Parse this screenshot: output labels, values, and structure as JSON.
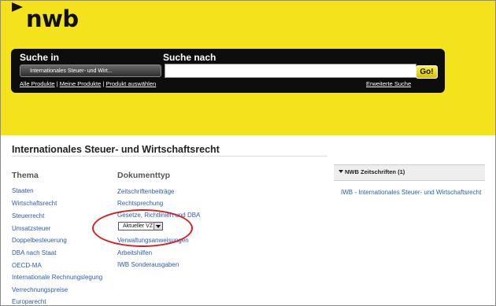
{
  "header": {
    "logo": "nwb",
    "search_in_label": "Suche in",
    "search_for_label": "Suche nach",
    "scope_value": "Internationales Steuer- und Wirt...",
    "query_value": "",
    "go_label": "Go!",
    "links": [
      "Alle Produkte",
      "Meine Produkte",
      "Produkt auswählen"
    ],
    "advanced_search": "Erweiterte Suche"
  },
  "page": {
    "title": "Internationales Steuer- und Wirtschaftsrecht"
  },
  "thema": {
    "heading": "Thema",
    "items": [
      "Staaten",
      "Wirtschaftsrecht",
      "Steuerrecht",
      "Umsatzsteuer",
      "Doppelbesteuerung",
      "DBA nach Staat",
      "OECD-MA",
      "Internationale Rechnungslegung",
      "Verrechnungspreise",
      "Europarecht"
    ]
  },
  "dokumenttyp": {
    "heading": "Dokumenttyp",
    "items": [
      "Zeitschriftenbeiträge",
      "Rechtsprechung",
      "Gesetze, Richtlinien und DBA",
      "Verwaltungsanweisungen",
      "Arbeitshilfen",
      "IWB Sonderausgaben"
    ],
    "select_value": "Aktueller VZ"
  },
  "sidebar": {
    "heading": "NWB Zeitschriften (1)",
    "items": [
      "IWB - Internationales Steuer- und Wirtschaftsrecht"
    ]
  },
  "colors": {
    "header_yellow": "#f3e21c",
    "search_bar": "#0d0d0d",
    "link_blue": "#2a5db0",
    "annotation_red": "#d42020"
  }
}
